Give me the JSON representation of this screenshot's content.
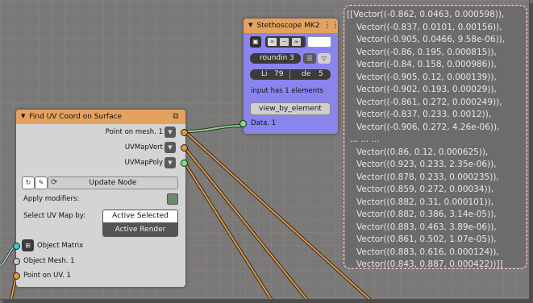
{
  "stethoscope": {
    "title": "Stethoscope MK2",
    "header_icon": "node-tree-icon",
    "rounding_label": "roundin",
    "rounding_value": "3",
    "lines_label": "Li",
    "lines_value": "79",
    "depth_label": "de",
    "depth_value": "5",
    "info": "input has 1 elements",
    "view_button": "view_by_element",
    "socket_label": "Data. 1"
  },
  "find_uv": {
    "title": "Find UV Coord on Surface",
    "header_icon": "node-group-icon",
    "outputs": [
      "Point on mesh. 1",
      "UVMapVert",
      "UVMapPoly"
    ],
    "update_button": "Update Node",
    "apply_modifiers_label": "Apply modifiers:",
    "select_uv_label": "Select UV Map by:",
    "uv_options": [
      "Active Selected",
      "Active Render"
    ],
    "inputs": [
      "Object Matrix",
      "Object Mesh. 1",
      "Point on UV. 1"
    ]
  },
  "viewer": {
    "lines": [
      "[[Vector((-0.862, 0.0463, 0.000598)),",
      "Vector((-0.837, 0.0101, 0.00156)),",
      "Vector((-0.905, 0.0466, 9.58e-06)),",
      "Vector((-0.86, 0.195, 0.000815)),",
      "Vector((-0.84, 0.158, 0.000986)),",
      "Vector((-0.905, 0.12, 0.000139)),",
      "Vector((-0.902, 0.193, 0.00029)),",
      "Vector((-0.861, 0.272, 0.000249)),",
      "Vector((-0.837, 0.233, 0.0012)),",
      "Vector((-0.906, 0.272, 4.26e-06)),",
      "... ... ...",
      "Vector((0.86, 0.12, 0.000625)),",
      "Vector((0.923, 0.233, 2.35e-06)),",
      "Vector((0.878, 0.233, 0.000235)),",
      "Vector((0.859, 0.272, 0.00034)),",
      "Vector((0.882, 0.31, 0.000101)),",
      "Vector((0.882, 0.386, 3.14e-05)),",
      "Vector((0.883, 0.463, 3.89e-06)),",
      "Vector((0.861, 0.502, 1.07e-05)),",
      "Vector((0.883, 0.616, 0.000124)),",
      "Vector((0.843, 0.887, 0.000422))]]"
    ]
  },
  "colors": {
    "node_header": "#e4a25e",
    "stethoscope_body": "#8a84ee",
    "wire_orange": "#e59a3c",
    "socket_green": "#7fe07f",
    "socket_cyan": "#40c8c8",
    "socket_orange": "#e5943a"
  }
}
